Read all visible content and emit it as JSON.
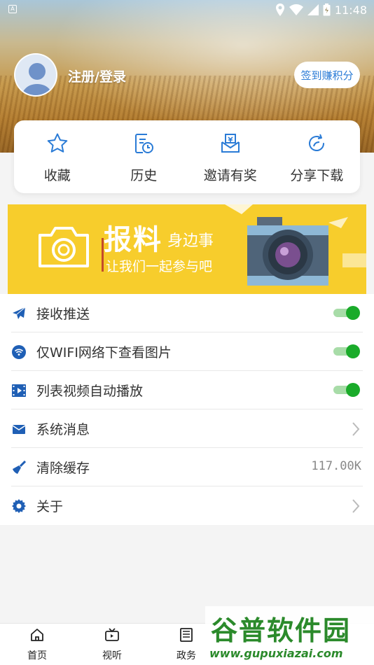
{
  "status_bar": {
    "time": "11:48",
    "notification_icon": "a-notification-icon"
  },
  "profile": {
    "login_label": "注册/登录",
    "checkin_label": "签到赚积分"
  },
  "quick_actions": [
    {
      "label": "收藏",
      "icon": "star-icon"
    },
    {
      "label": "历史",
      "icon": "history-icon"
    },
    {
      "label": "邀请有奖",
      "icon": "invite-icon"
    },
    {
      "label": "分享下载",
      "icon": "share-icon"
    }
  ],
  "banner": {
    "title_big": "报料",
    "title_small": "身边事",
    "subtitle": "让我们一起参与吧"
  },
  "settings": [
    {
      "label": "接收推送",
      "icon": "send-icon",
      "control": "toggle",
      "on": true
    },
    {
      "label": "仅WIFI网络下查看图片",
      "icon": "wifi-icon",
      "control": "toggle",
      "on": true
    },
    {
      "label": "列表视频自动播放",
      "icon": "video-icon",
      "control": "toggle",
      "on": true
    },
    {
      "label": "系统消息",
      "icon": "mail-icon",
      "control": "chevron"
    },
    {
      "label": "清除缓存",
      "icon": "broom-icon",
      "control": "value",
      "value": "117.00K"
    },
    {
      "label": "关于",
      "icon": "gear-icon",
      "control": "chevron"
    }
  ],
  "bottom_nav": [
    {
      "label": "首页",
      "icon": "home-icon"
    },
    {
      "label": "视听",
      "icon": "tv-icon"
    },
    {
      "label": "政务",
      "icon": "news-icon"
    }
  ],
  "watermark": {
    "big": "谷普软件园",
    "small": "www.gupuxiazai.com"
  },
  "colors": {
    "accent_blue": "#2a7bd6",
    "toggle_green": "#1aab2a",
    "banner_yellow": "#f7cd2c"
  }
}
